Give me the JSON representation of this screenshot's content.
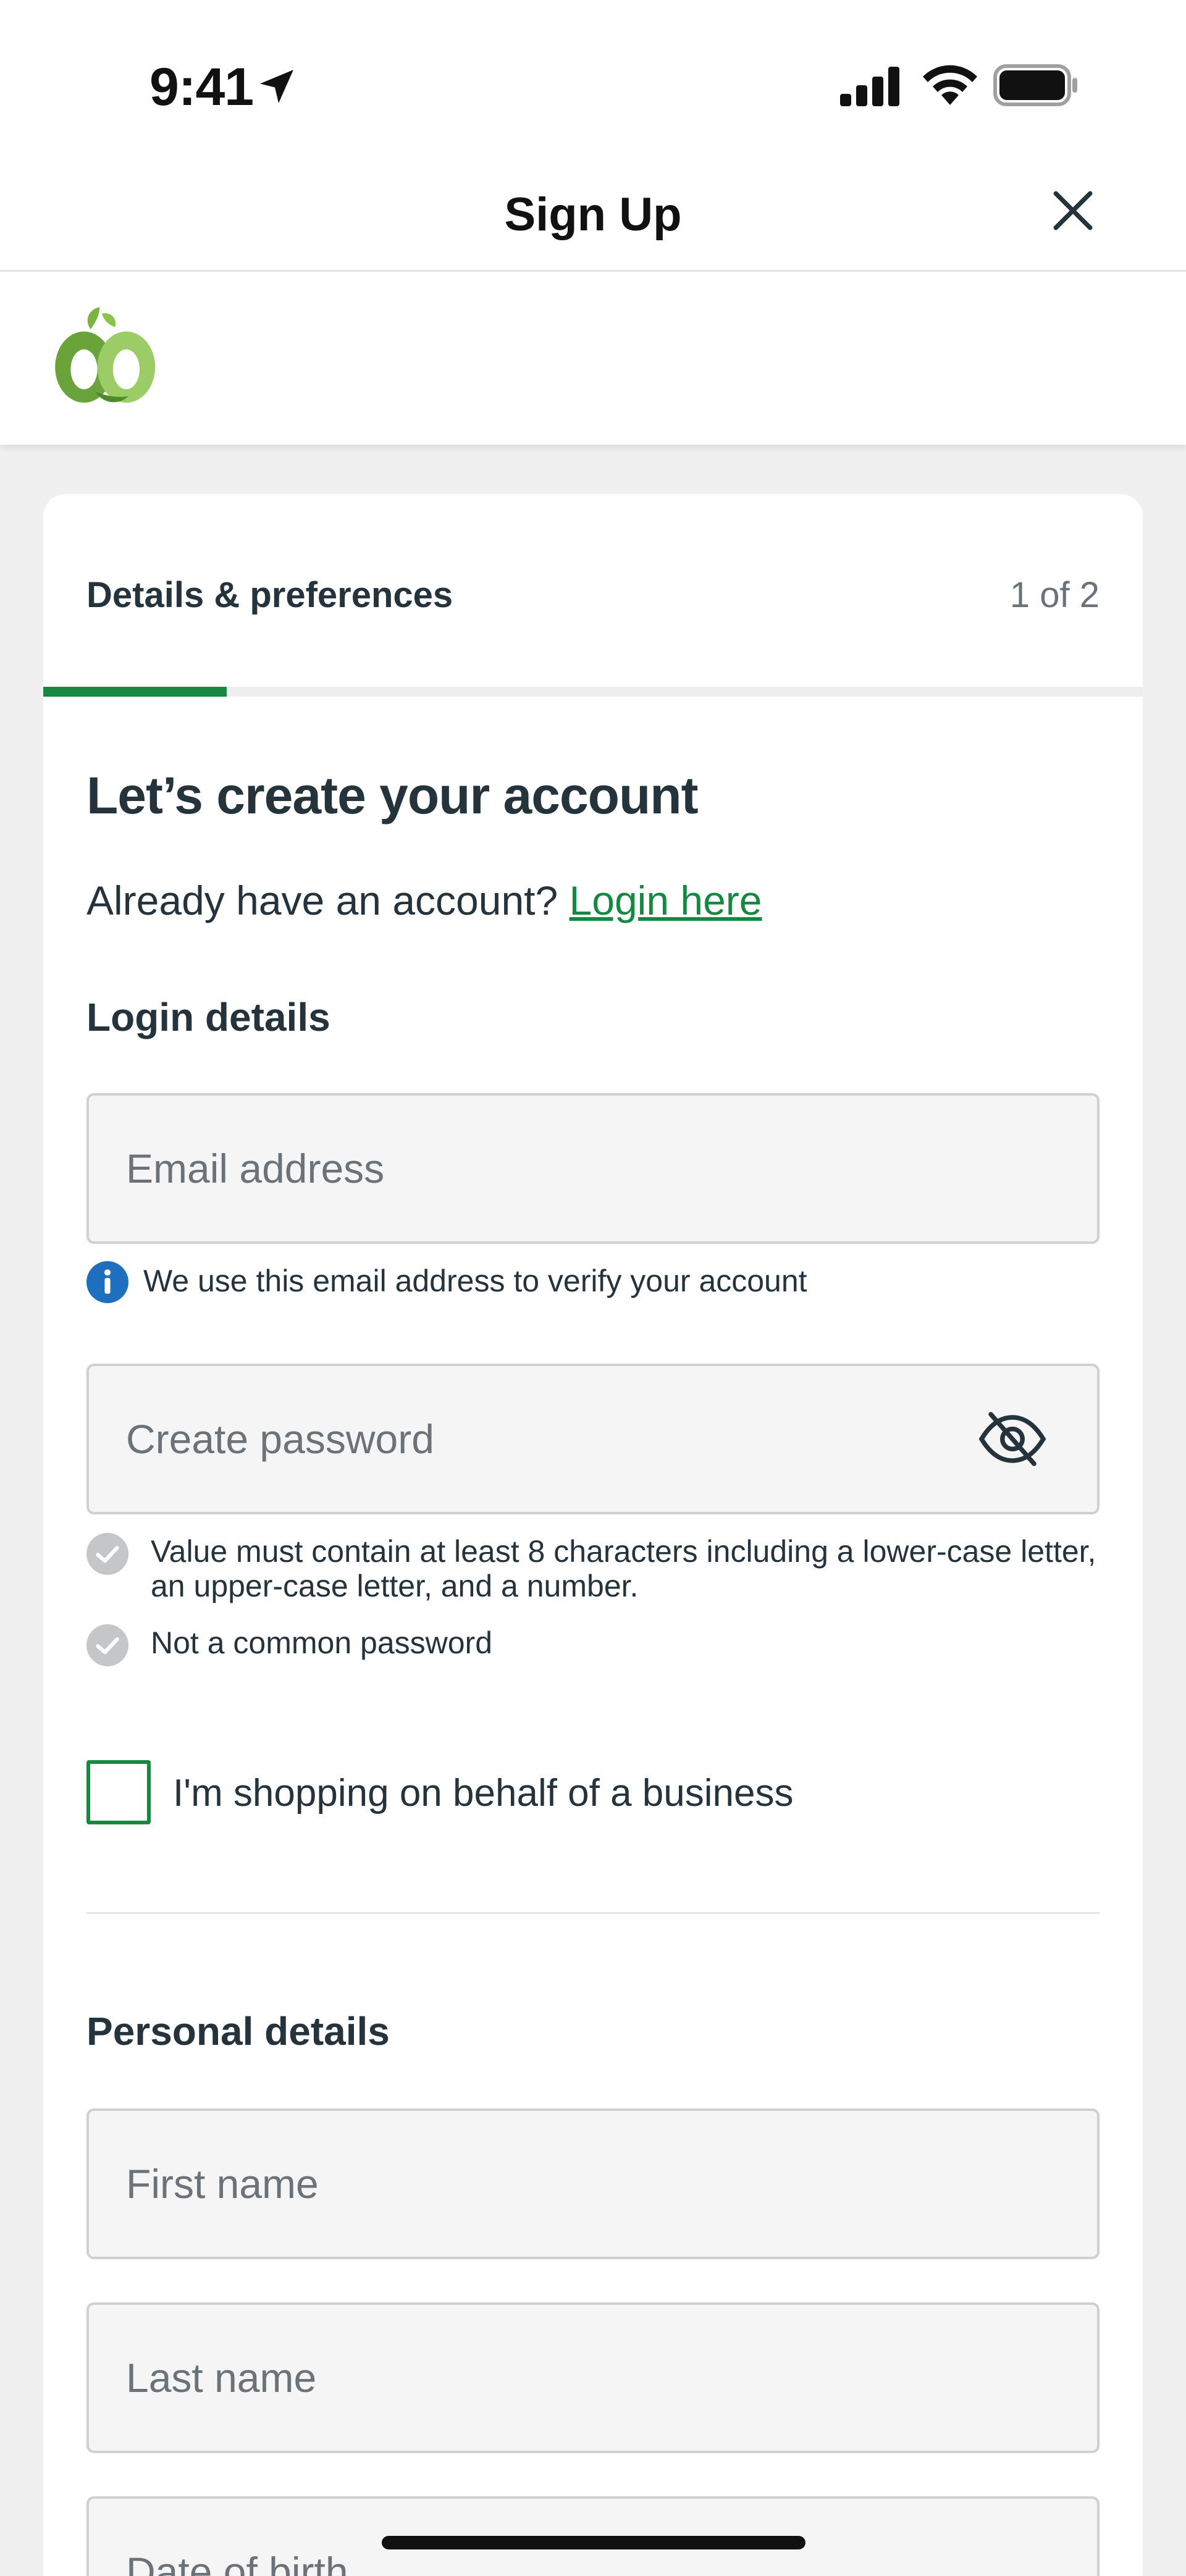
{
  "status_bar": {
    "time": "9:41"
  },
  "header": {
    "title": "Sign Up"
  },
  "progress": {
    "step_title": "Details & preferences",
    "step_count": "1 of 2",
    "fraction": 0.167,
    "accent_color": "#178841"
  },
  "main": {
    "heading": "Let’s create your account",
    "login_prompt": "Already have an account?",
    "login_link": "Login here"
  },
  "login_section": {
    "title": "Login details",
    "email_placeholder": "Email address",
    "email_hint": "We use this email address to verify your account",
    "password_placeholder": "Create password",
    "requirements": [
      "Value must contain at least 8 characters including a lower-case letter, an upper-case letter, and a number.",
      "Not a common password"
    ],
    "business_checkbox_label": "I'm shopping on behalf of a business"
  },
  "personal_section": {
    "title": "Personal details",
    "first_name_placeholder": "First name",
    "last_name_placeholder": "Last name",
    "dob_placeholder": "Date of birth"
  },
  "icons": {
    "status": [
      "location-arrow-icon",
      "cellular-signal-icon",
      "wifi-icon",
      "battery-icon"
    ],
    "header": "close-icon",
    "brand": "woolworths-logo",
    "password": "eye-slash-icon",
    "info": "info-icon",
    "requirement": "check-circle-icon"
  }
}
